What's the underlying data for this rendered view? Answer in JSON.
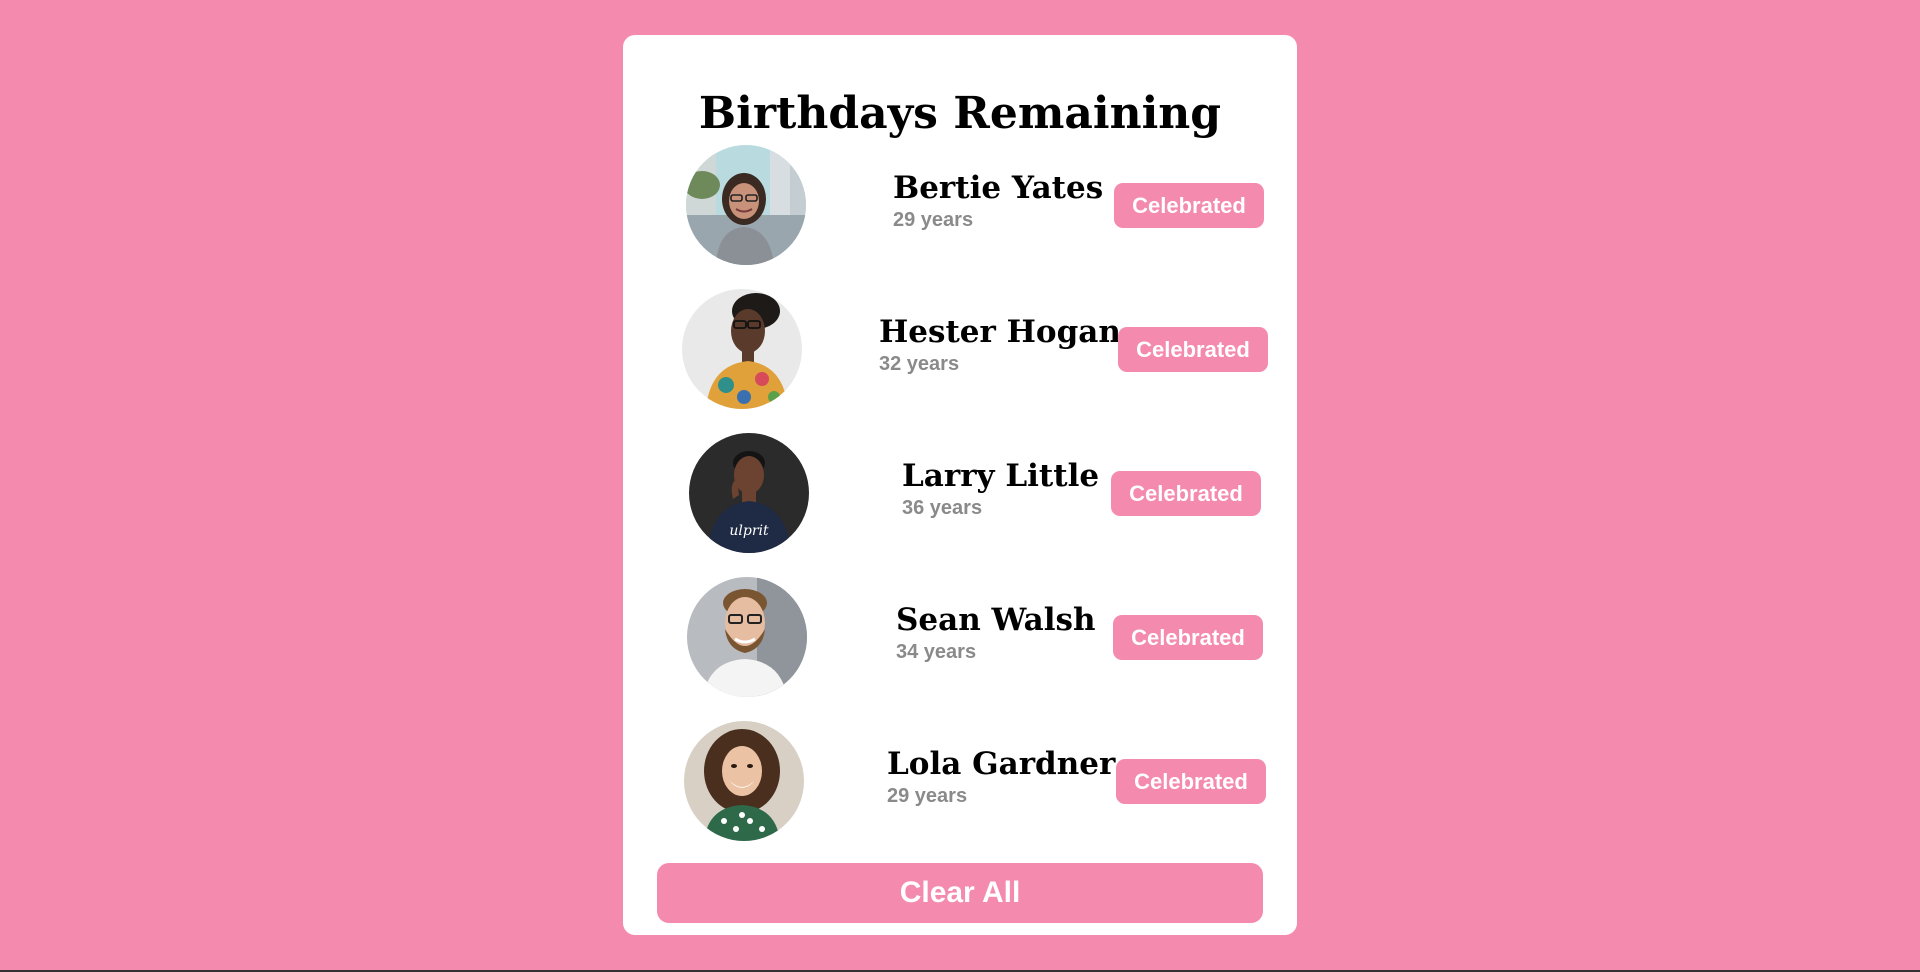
{
  "page": {
    "title": "Birthdays Remaining",
    "clear_all_label": "Clear All",
    "background_color": "#f48aae",
    "accent_color": "#f48aae",
    "card_color": "#ffffff"
  },
  "people": [
    {
      "name": "Bertie Yates",
      "age": "29 years",
      "button_label": "Celebrated",
      "avatar": "woman-with-glasses-city-street-photo"
    },
    {
      "name": "Hester Hogan",
      "age": "32 years",
      "button_label": "Celebrated",
      "avatar": "woman-with-glasses-floral-top-photo"
    },
    {
      "name": "Larry Little",
      "age": "36 years",
      "button_label": "Celebrated",
      "avatar": "man-dark-background-shirt-photo"
    },
    {
      "name": "Sean Walsh",
      "age": "34 years",
      "button_label": "Celebrated",
      "avatar": "man-with-glasses-beard-photo"
    },
    {
      "name": "Lola Gardner",
      "age": "29 years",
      "button_label": "Celebrated",
      "avatar": "smiling-woman-curly-hair-photo"
    }
  ]
}
